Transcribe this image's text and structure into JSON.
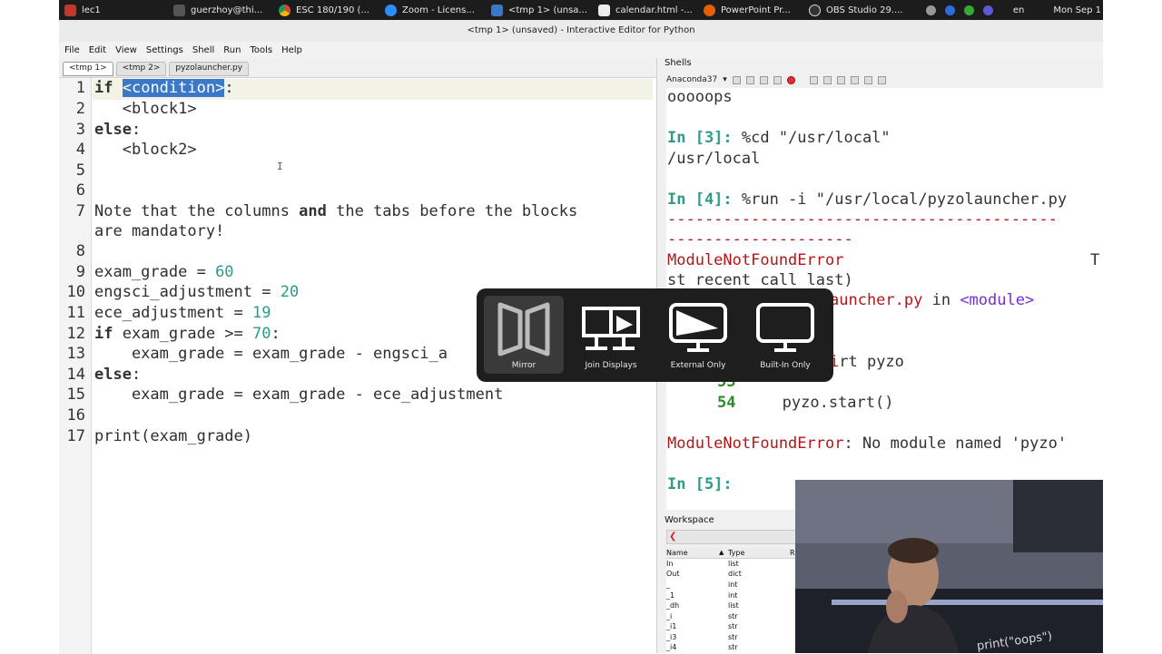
{
  "taskbar": {
    "tasks": [
      {
        "label": "lec1",
        "icon": "folder-icon",
        "color": "#c0392b"
      },
      {
        "label": "guerzhoy@thi...",
        "icon": "terminal-icon",
        "color": "#555555"
      },
      {
        "label": "ESC 180/190 (...",
        "icon": "chrome-icon",
        "color": "#e5b400"
      },
      {
        "label": "Zoom - Licens...",
        "icon": "zoom-icon",
        "color": "#2d8cff"
      },
      {
        "label": "<tmp 1> (unsa...",
        "icon": "pyzo-icon",
        "color": "#3b78c7"
      },
      {
        "label": "calendar.html -...",
        "icon": "editor-icon",
        "color": "#eeeeee"
      },
      {
        "label": "PowerPoint Pr...",
        "icon": "firefox-icon",
        "color": "#e66000"
      },
      {
        "label": "OBS Studio 29....",
        "icon": "obs-icon",
        "color": "#333333"
      }
    ],
    "language": "en",
    "clock": "Mon Sep 1"
  },
  "window": {
    "title": "<tmp 1> (unsaved) - Interactive Editor for Python"
  },
  "menu": [
    "File",
    "Edit",
    "View",
    "Settings",
    "Shell",
    "Run",
    "Tools",
    "Help"
  ],
  "editor": {
    "tabs": [
      {
        "label": "<tmp 1>",
        "active": true
      },
      {
        "label": "<tmp 2>",
        "active": false
      },
      {
        "label": "pyzolauncher.py",
        "active": false
      }
    ],
    "line_numbers": [
      "1",
      "2",
      "3",
      "4",
      "5",
      "6",
      "7",
      "8",
      "9",
      "10",
      "11",
      "12",
      "13",
      "14",
      "15",
      "16",
      "17"
    ],
    "lines": {
      "l1_kw": "if",
      "l1_sel": "<condition>",
      "l1_end": ":",
      "l2": "   <block1>",
      "l3_kw": "else",
      "l3_end": ":",
      "l4": "   <block2>",
      "l7_a": "Note that the columns ",
      "l7_and": "and",
      "l7_b": " the tabs before the blocks",
      "l7_wrap": "are mandatory!",
      "l9_a": "exam_grade = ",
      "l9_num": "60",
      "l10_a": "engsci_adjustment = ",
      "l10_num": "20",
      "l11_a": "ece_adjustment = ",
      "l11_num": "19",
      "l12_kw": "if",
      "l12_a": " exam_grade >= ",
      "l12_num": "70",
      "l12_end": ":",
      "l13": "    exam_grade = exam_grade - engsci_a",
      "l14_kw": "else",
      "l14_end": ":",
      "l15": "    exam_grade = exam_grade - ece_adjustment",
      "l17": "print(exam_grade)"
    }
  },
  "shells": {
    "label": "Shells",
    "interpreter": "Anaconda37",
    "lines": {
      "s1": "ooooops",
      "p3": "In [3]:",
      "c3": " %cd \"/usr/local\"",
      "o3": "/usr/local",
      "p4": "In [4]:",
      "c4": " %run -i \"/usr/local/pyzolauncher.py",
      "dash1": "------------------------------------------",
      "dash2": "--------------------",
      "err1": "ModuleNotFoundError",
      "err1_tail": "T",
      "tb1": "st recent call last)",
      "tb2": "auncher.py",
      "tb2_in": " in ",
      "tb2_mod": "<module>",
      "tb3": "rt pyzo",
      "tbn53": "53",
      "tbn54": "54",
      "tb54": "     pyzo.start()",
      "err2": "ModuleNotFoundError",
      "err2_msg": ": No module named 'pyzo'",
      "p5": "In [5]:"
    }
  },
  "workspace": {
    "label": "Workspace",
    "col_name": "Name",
    "col_type": "Type",
    "col_rep": "R",
    "rows": [
      {
        "name": "In",
        "type": "list"
      },
      {
        "name": "Out",
        "type": "dict"
      },
      {
        "name": "_",
        "type": "int"
      },
      {
        "name": "_1",
        "type": "int"
      },
      {
        "name": "_dh",
        "type": "list"
      },
      {
        "name": "_i",
        "type": "str"
      },
      {
        "name": "_i1",
        "type": "str"
      },
      {
        "name": "_i3",
        "type": "str"
      },
      {
        "name": "_i4",
        "type": "str"
      }
    ]
  },
  "display_switcher": {
    "options": [
      {
        "label": "Mirror",
        "icon": "mirror-icon",
        "selected": true
      },
      {
        "label": "Join Displays",
        "icon": "join-displays-icon",
        "selected": false
      },
      {
        "label": "External Only",
        "icon": "external-only-icon",
        "selected": false
      },
      {
        "label": "Built-In Only",
        "icon": "built-in-only-icon",
        "selected": false
      }
    ]
  },
  "webcam": {
    "board_text": "print(\"oops\")"
  }
}
